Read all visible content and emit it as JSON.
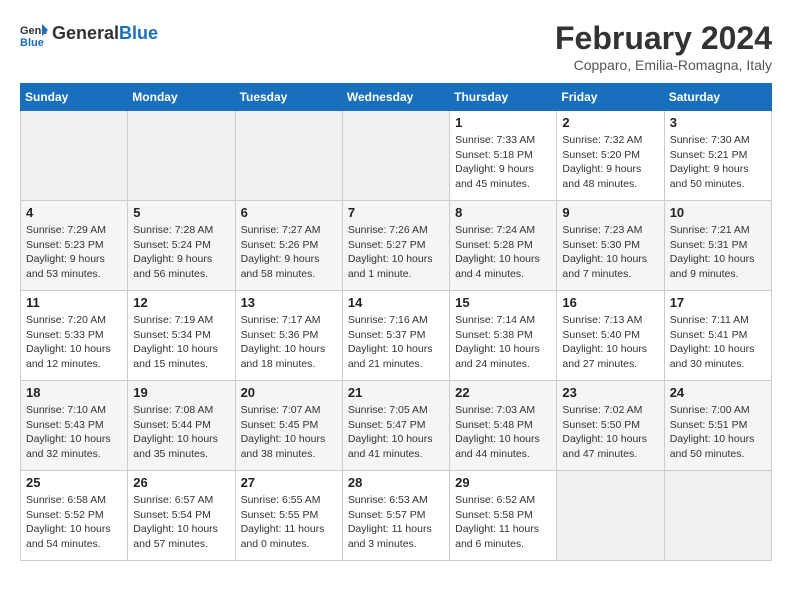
{
  "header": {
    "logo": {
      "general": "General",
      "blue": "Blue"
    },
    "title": "February 2024",
    "subtitle": "Copparo, Emilia-Romagna, Italy"
  },
  "days_of_week": [
    "Sunday",
    "Monday",
    "Tuesday",
    "Wednesday",
    "Thursday",
    "Friday",
    "Saturday"
  ],
  "weeks": [
    [
      {
        "day": "",
        "empty": true
      },
      {
        "day": "",
        "empty": true
      },
      {
        "day": "",
        "empty": true
      },
      {
        "day": "",
        "empty": true
      },
      {
        "day": "1",
        "sunrise": "7:33 AM",
        "sunset": "5:18 PM",
        "daylight": "9 hours and 45 minutes."
      },
      {
        "day": "2",
        "sunrise": "7:32 AM",
        "sunset": "5:20 PM",
        "daylight": "9 hours and 48 minutes."
      },
      {
        "day": "3",
        "sunrise": "7:30 AM",
        "sunset": "5:21 PM",
        "daylight": "9 hours and 50 minutes."
      }
    ],
    [
      {
        "day": "4",
        "sunrise": "7:29 AM",
        "sunset": "5:23 PM",
        "daylight": "9 hours and 53 minutes."
      },
      {
        "day": "5",
        "sunrise": "7:28 AM",
        "sunset": "5:24 PM",
        "daylight": "9 hours and 56 minutes."
      },
      {
        "day": "6",
        "sunrise": "7:27 AM",
        "sunset": "5:26 PM",
        "daylight": "9 hours and 58 minutes."
      },
      {
        "day": "7",
        "sunrise": "7:26 AM",
        "sunset": "5:27 PM",
        "daylight": "10 hours and 1 minute."
      },
      {
        "day": "8",
        "sunrise": "7:24 AM",
        "sunset": "5:28 PM",
        "daylight": "10 hours and 4 minutes."
      },
      {
        "day": "9",
        "sunrise": "7:23 AM",
        "sunset": "5:30 PM",
        "daylight": "10 hours and 7 minutes."
      },
      {
        "day": "10",
        "sunrise": "7:21 AM",
        "sunset": "5:31 PM",
        "daylight": "10 hours and 9 minutes."
      }
    ],
    [
      {
        "day": "11",
        "sunrise": "7:20 AM",
        "sunset": "5:33 PM",
        "daylight": "10 hours and 12 minutes."
      },
      {
        "day": "12",
        "sunrise": "7:19 AM",
        "sunset": "5:34 PM",
        "daylight": "10 hours and 15 minutes."
      },
      {
        "day": "13",
        "sunrise": "7:17 AM",
        "sunset": "5:36 PM",
        "daylight": "10 hours and 18 minutes."
      },
      {
        "day": "14",
        "sunrise": "7:16 AM",
        "sunset": "5:37 PM",
        "daylight": "10 hours and 21 minutes."
      },
      {
        "day": "15",
        "sunrise": "7:14 AM",
        "sunset": "5:38 PM",
        "daylight": "10 hours and 24 minutes."
      },
      {
        "day": "16",
        "sunrise": "7:13 AM",
        "sunset": "5:40 PM",
        "daylight": "10 hours and 27 minutes."
      },
      {
        "day": "17",
        "sunrise": "7:11 AM",
        "sunset": "5:41 PM",
        "daylight": "10 hours and 30 minutes."
      }
    ],
    [
      {
        "day": "18",
        "sunrise": "7:10 AM",
        "sunset": "5:43 PM",
        "daylight": "10 hours and 32 minutes."
      },
      {
        "day": "19",
        "sunrise": "7:08 AM",
        "sunset": "5:44 PM",
        "daylight": "10 hours and 35 minutes."
      },
      {
        "day": "20",
        "sunrise": "7:07 AM",
        "sunset": "5:45 PM",
        "daylight": "10 hours and 38 minutes."
      },
      {
        "day": "21",
        "sunrise": "7:05 AM",
        "sunset": "5:47 PM",
        "daylight": "10 hours and 41 minutes."
      },
      {
        "day": "22",
        "sunrise": "7:03 AM",
        "sunset": "5:48 PM",
        "daylight": "10 hours and 44 minutes."
      },
      {
        "day": "23",
        "sunrise": "7:02 AM",
        "sunset": "5:50 PM",
        "daylight": "10 hours and 47 minutes."
      },
      {
        "day": "24",
        "sunrise": "7:00 AM",
        "sunset": "5:51 PM",
        "daylight": "10 hours and 50 minutes."
      }
    ],
    [
      {
        "day": "25",
        "sunrise": "6:58 AM",
        "sunset": "5:52 PM",
        "daylight": "10 hours and 54 minutes."
      },
      {
        "day": "26",
        "sunrise": "6:57 AM",
        "sunset": "5:54 PM",
        "daylight": "10 hours and 57 minutes."
      },
      {
        "day": "27",
        "sunrise": "6:55 AM",
        "sunset": "5:55 PM",
        "daylight": "11 hours and 0 minutes."
      },
      {
        "day": "28",
        "sunrise": "6:53 AM",
        "sunset": "5:57 PM",
        "daylight": "11 hours and 3 minutes."
      },
      {
        "day": "29",
        "sunrise": "6:52 AM",
        "sunset": "5:58 PM",
        "daylight": "11 hours and 6 minutes."
      },
      {
        "day": "",
        "empty": true
      },
      {
        "day": "",
        "empty": true
      }
    ]
  ]
}
